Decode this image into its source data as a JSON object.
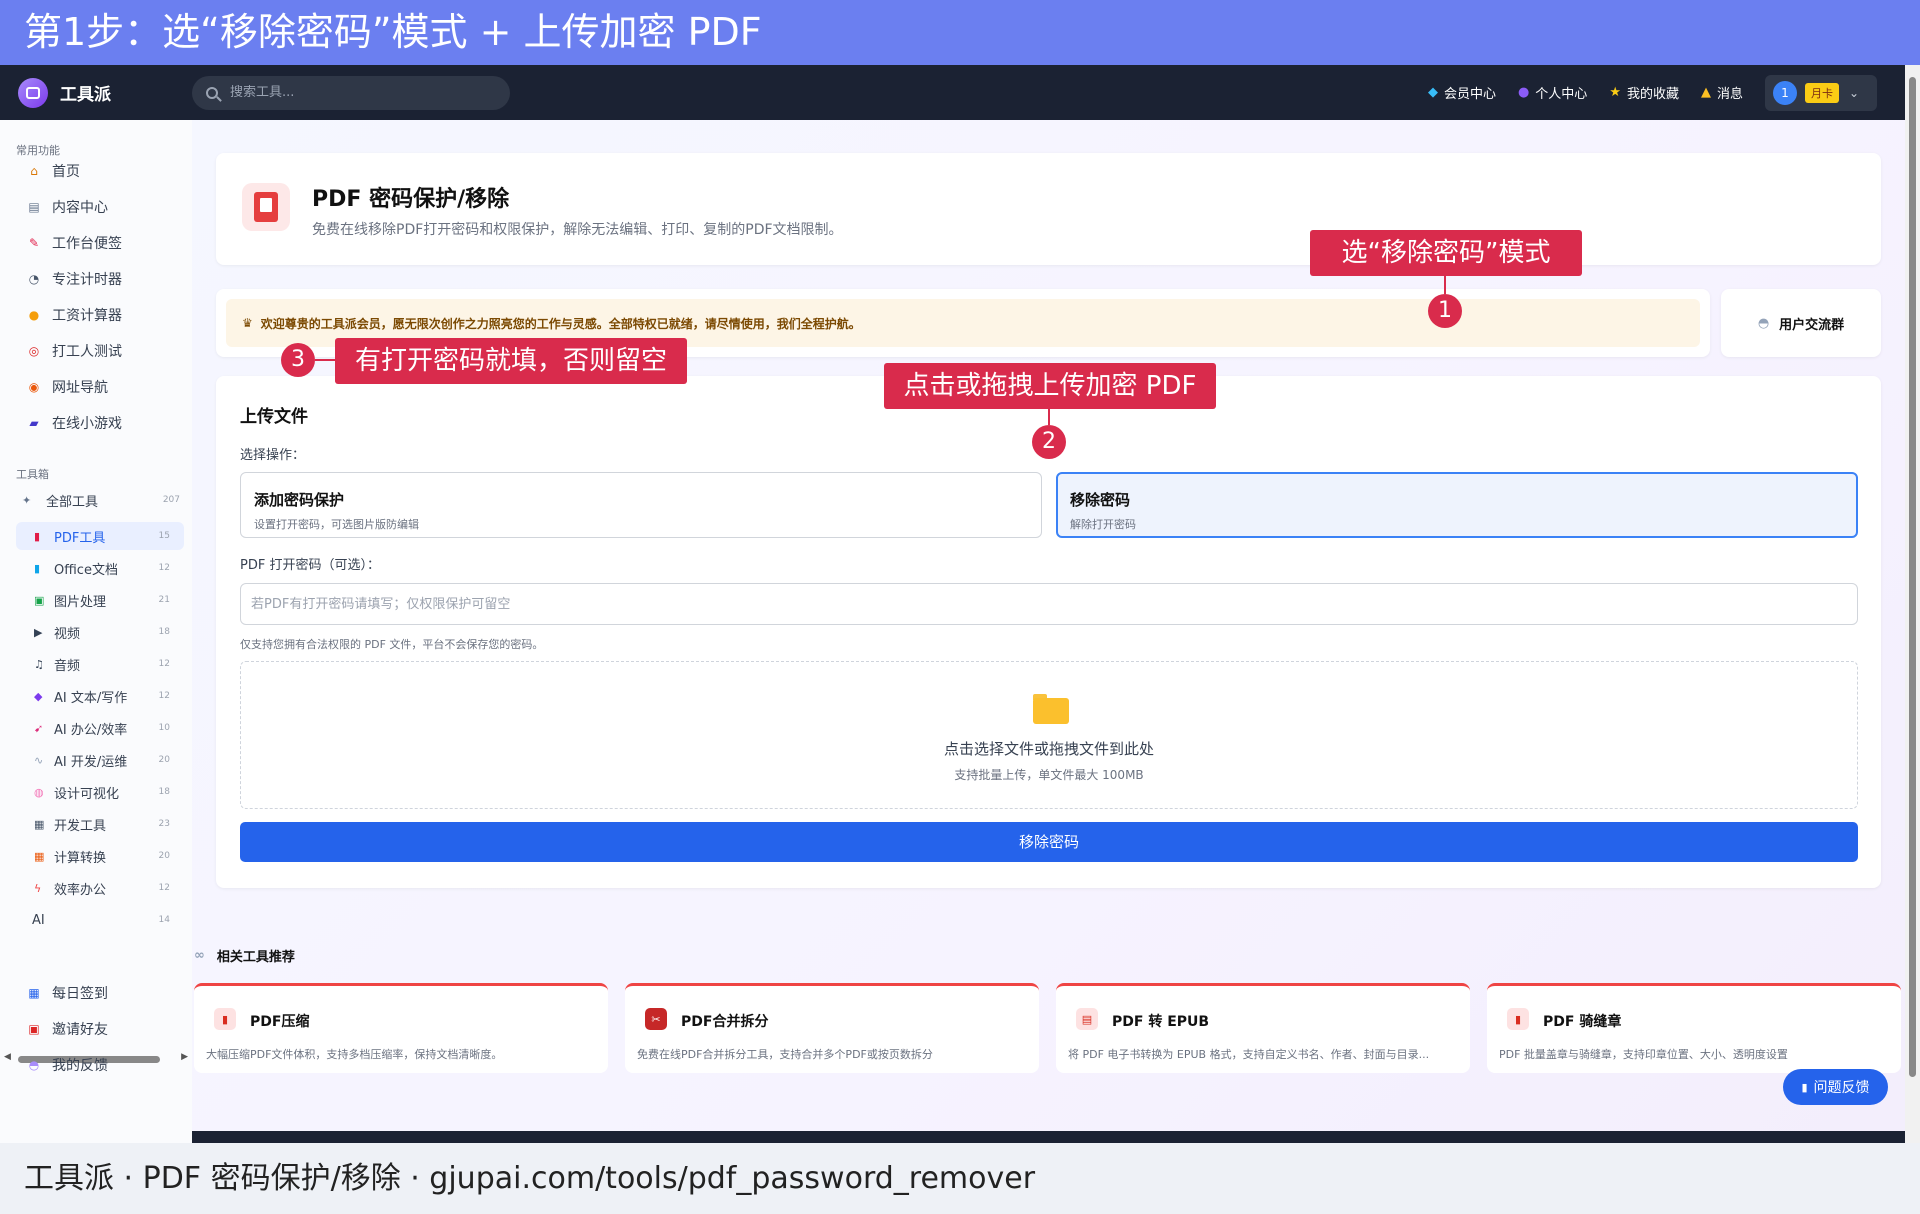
{
  "banner": {
    "text": "第1步：选“移除密码”模式 + 上传加密 PDF"
  },
  "footer": {
    "text": "工具派 · PDF 密码保护/移除 · gjupai.com/tools/pdf_password_remover"
  },
  "topnav": {
    "logo": "工具派",
    "search_placeholder": "搜索工具...",
    "items": [
      {
        "icon": "diamond-icon",
        "label": "会员中心"
      },
      {
        "icon": "user-icon",
        "label": "个人中心"
      },
      {
        "icon": "star-icon",
        "label": "我的收藏"
      },
      {
        "icon": "bell-icon",
        "label": "消息"
      }
    ],
    "user": {
      "avatar": "1",
      "badge": "月卡"
    }
  },
  "sidebar": {
    "common_title": "常用功能",
    "common": [
      {
        "icon": "home-icon",
        "label": "首页"
      },
      {
        "icon": "content-icon",
        "label": "内容中心"
      },
      {
        "icon": "note-icon",
        "label": "工作台便签"
      },
      {
        "icon": "timer-icon",
        "label": "专注计时器"
      },
      {
        "icon": "salary-icon",
        "label": "工资计算器"
      },
      {
        "icon": "target-icon",
        "label": "打工人测试"
      },
      {
        "icon": "globe-icon",
        "label": "网址导航"
      },
      {
        "icon": "gamepad-icon",
        "label": "在线小游戏"
      }
    ],
    "tools_title": "工具箱",
    "all_tools": {
      "label": "全部工具",
      "count": "207"
    },
    "tools": [
      {
        "icon": "pdf-icon",
        "label": "PDF工具",
        "count": "15",
        "active": true
      },
      {
        "icon": "office-icon",
        "label": "Office文档",
        "count": "12"
      },
      {
        "icon": "image-icon",
        "label": "图片处理",
        "count": "21"
      },
      {
        "icon": "video-icon",
        "label": "视频",
        "count": "18"
      },
      {
        "icon": "music-icon",
        "label": "音频",
        "count": "12"
      },
      {
        "icon": "ai-write-icon",
        "label": "AI 文本/写作",
        "count": "12"
      },
      {
        "icon": "ai-office-icon",
        "label": "AI 办公/效率",
        "count": "10"
      },
      {
        "icon": "ai-dev-icon",
        "label": "AI 开发/运维",
        "count": "20"
      },
      {
        "icon": "palette-icon",
        "label": "设计可视化",
        "count": "18"
      },
      {
        "icon": "dev-icon",
        "label": "开发工具",
        "count": "23"
      },
      {
        "icon": "calc-icon",
        "label": "计算转换",
        "count": "20"
      },
      {
        "icon": "bolt-icon",
        "label": "效率办公",
        "count": "12"
      },
      {
        "icon": "",
        "label": "AI",
        "count": "14"
      }
    ],
    "bottom": [
      {
        "icon": "calendar-icon",
        "label": "每日签到"
      },
      {
        "icon": "gift-icon",
        "label": "邀请好友"
      },
      {
        "icon": "chat-icon",
        "label": "我的反馈"
      }
    ]
  },
  "header": {
    "title": "PDF 密码保护/移除",
    "desc": "免费在线移除PDF打开密码和权限保护，解除无法编辑、打印、复制的PDF文档限制。"
  },
  "welcome": {
    "text": "欢迎尊贵的工具派会员，愿无限次创作之力照亮您的工作与灵感。全部特权已就绪，请尽情使用，我们全程护航。"
  },
  "group": {
    "label": "用户交流群"
  },
  "upload": {
    "title": "上传文件",
    "op_label": "选择操作：",
    "ops": [
      {
        "title": "添加密码保护",
        "sub": "设置打开密码，可选图片版防编辑"
      },
      {
        "title": "移除密码",
        "sub": "解除打开密码",
        "selected": true
      }
    ],
    "pw_label": "PDF 打开密码（可选）：",
    "pw_placeholder": "若PDF有打开密码请填写；仅权限保护可留空",
    "pw_value": "",
    "note": "仅支持您拥有合法权限的 PDF 文件，平台不会保存您的密码。",
    "drop_main": "点击选择文件或拖拽文件到此处",
    "drop_sub": "支持批量上传，单文件最大 100MB",
    "submit": "移除密码"
  },
  "related": {
    "title": "相关工具推荐",
    "items": [
      {
        "title": "PDF压缩",
        "desc": "大幅压缩PDF文件体积，支持多档压缩率，保持文档清晰度。"
      },
      {
        "title": "PDF合并拆分",
        "desc": "免费在线PDF合并拆分工具，支持合并多个PDF或按页数拆分"
      },
      {
        "title": "PDF 转 EPUB",
        "desc": "将 PDF 电子书转换为 EPUB 格式，支持自定义书名、作者、封面与目录..."
      },
      {
        "title": "PDF 骑缝章",
        "desc": "PDF 批量盖章与骑缝章，支持印章位置、大小、透明度设置"
      }
    ]
  },
  "feedback": {
    "label": "问题反馈"
  },
  "callouts": [
    {
      "num": "1",
      "text": "选“移除密码”模式"
    },
    {
      "num": "2",
      "text": "点击或拖拽上传加密 PDF"
    },
    {
      "num": "3",
      "text": "有打开密码就填，否则留空"
    }
  ],
  "colors": {
    "accent": "#2563eb",
    "callout": "#d92b4c",
    "banner": "#6b7ff0",
    "nav": "#1b2233"
  }
}
